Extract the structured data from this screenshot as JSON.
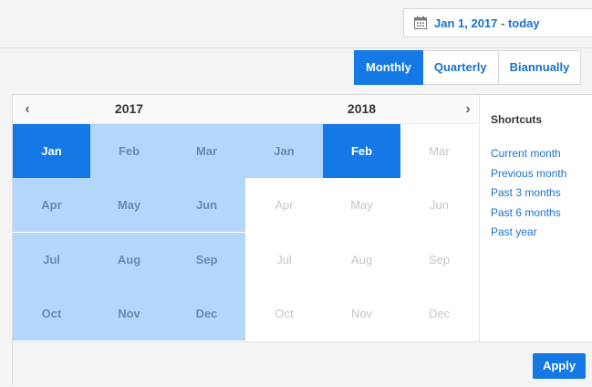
{
  "header": {
    "date_range": "Jan 1, 2017 - today",
    "date_icon": "calendar-icon"
  },
  "period_tabs": [
    {
      "label": "Monthly",
      "active": true
    },
    {
      "label": "Quarterly",
      "active": false
    },
    {
      "label": "Biannually",
      "active": false
    }
  ],
  "calendar": {
    "prev_arrow": "‹",
    "next_arrow": "›",
    "years": [
      "2017",
      "2018"
    ],
    "months_2017": [
      "Jan",
      "Feb",
      "Mar",
      "Apr",
      "May",
      "Jun",
      "Jul",
      "Aug",
      "Sep",
      "Oct",
      "Nov",
      "Dec"
    ],
    "months_2018": [
      "Jan",
      "Feb",
      "Mar",
      "Apr",
      "May",
      "Jun",
      "Jul",
      "Aug",
      "Sep",
      "Oct",
      "Nov",
      "Dec"
    ],
    "selected_start": "Jan 2017",
    "selected_end": "Feb 2018",
    "colors": {
      "selected": "#1478e5",
      "range": "#b3d7fb",
      "disabled_text": "#c6c6c6"
    }
  },
  "shortcuts": {
    "title": "Shortcuts",
    "items": [
      "Current month",
      "Previous month",
      "Past 3 months",
      "Past 6 months",
      "Past year"
    ]
  },
  "footer": {
    "apply_label": "Apply"
  }
}
